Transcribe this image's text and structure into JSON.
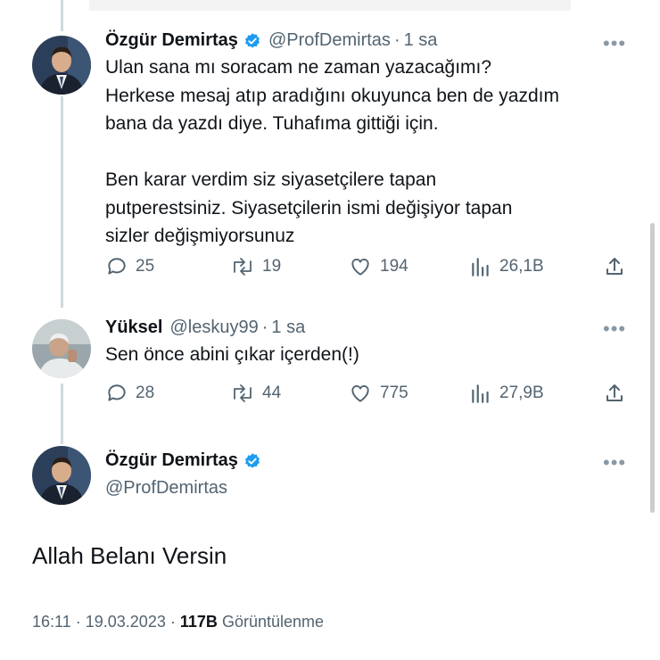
{
  "tweet1": {
    "name": "Özgür Demirtaş",
    "handle": "@ProfDemirtas",
    "time": "1 sa",
    "text": "Ulan sana mı soracam ne zaman yazacağımı?\nHerkese mesaj atıp aradığını okuyunca ben de yazdım\nbana da yazdı diye. Tuhafıma gittiği için.\n\nBen karar verdim siz siyasetçilere tapan\nputperestsiniz. Siyasetçilerin ismi değişiyor tapan\nsizler değişmiyorsunuz",
    "replies": "25",
    "retweets": "19",
    "likes": "194",
    "views": "26,1B"
  },
  "tweet2": {
    "name": "Yüksel",
    "handle": "@leskuy99",
    "time": "1 sa",
    "text": "Sen önce abini çıkar içerden(!)",
    "replies": "28",
    "retweets": "44",
    "likes": "775",
    "views": "27,9B"
  },
  "focus": {
    "name": "Özgür Demirtaş",
    "handle": "@ProfDemirtas",
    "text": "Allah Belanı Versin",
    "time": "16:11",
    "date": "19.03.2023",
    "views_count": "117B",
    "views_label": "Görüntülenme"
  },
  "separator": "·",
  "more_glyph": "•••",
  "colors": {
    "verified": "#1d9bf0",
    "muted": "#536471",
    "thread_line": "#cfd9de"
  }
}
